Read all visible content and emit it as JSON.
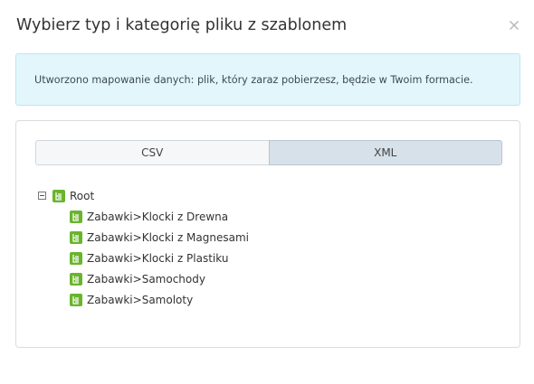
{
  "dialog": {
    "title": "Wybierz typ i kategorię pliku z szablonem"
  },
  "alert": {
    "message": "Utworzono mapowanie danych: plik, który zaraz pobierzesz, będzie w Twoim formacie."
  },
  "tabs": [
    {
      "label": "CSV",
      "active": false
    },
    {
      "label": "XML",
      "active": true
    }
  ],
  "tree": {
    "root": {
      "label": "Root",
      "expanded": true,
      "children": [
        {
          "label": "Zabawki>Klocki z Drewna"
        },
        {
          "label": "Zabawki>Klocki z Magnesami"
        },
        {
          "label": "Zabawki>Klocki z Plastiku"
        },
        {
          "label": "Zabawki>Samochody"
        },
        {
          "label": "Zabawki>Samoloty"
        }
      ]
    }
  },
  "colors": {
    "node_icon": "#6ab42d",
    "alert_bg": "#e3f6fb",
    "active_tab_bg": "#d6e1ea"
  },
  "icons": {
    "close": "close-icon",
    "toggle": "collapse-minus-icon",
    "node": "category-node-icon"
  }
}
